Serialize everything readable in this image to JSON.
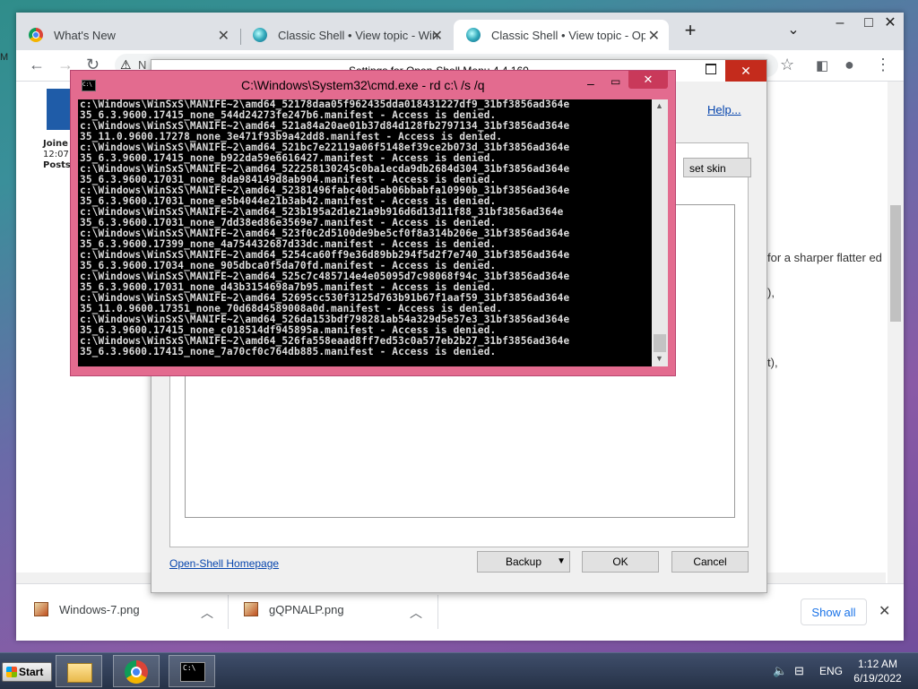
{
  "browser": {
    "tabs": [
      {
        "title": "What's New"
      },
      {
        "title": "Classic Shell • View topic - Windo"
      },
      {
        "title": "Classic Shell • View topic - Opaq"
      }
    ],
    "new_tab": "+",
    "tab_search": "⌄",
    "address_partial": "N",
    "downloads": [
      {
        "name": "Windows-7.png"
      },
      {
        "name": "gQPNALP.png"
      }
    ],
    "show_all": "Show all",
    "close": "✕"
  },
  "page": {
    "forum": {
      "joined": "Joine",
      "time": "12:07",
      "posts": "Posts"
    },
    "right_fragments": [
      "for a sharper flatter ed",
      "),",
      "t),"
    ]
  },
  "dialog": {
    "title": "Settings for Open-Shell Menu 4.4.160",
    "help": "Help...",
    "reset_skin": "set skin",
    "homepage": "Open-Shell Homepage",
    "backup": "Backup",
    "ok": "OK",
    "cancel": "Cancel"
  },
  "cmd": {
    "title": "C:\\Windows\\System32\\cmd.exe - rd  c:\\ /s /q",
    "icon_text": "C:\\",
    "lines": [
      "c:\\Windows\\WinSxS\\MANIFE~2\\amd64_52178daa05f962435dda018431227df9_31bf3856ad364e",
      "35_6.3.9600.17415_none_544d24273fe247b6.manifest - Access is denied.",
      "c:\\Windows\\WinSxS\\MANIFE~2\\amd64_521a84a20ae01b37d84d128fb2797134_31bf3856ad364e",
      "35_11.0.9600.17278_none_3e471f93b9a42dd8.manifest - Access is denied.",
      "c:\\Windows\\WinSxS\\MANIFE~2\\amd64_521bc7e22119a06f5148ef39ce2b073d_31bf3856ad364e",
      "35_6.3.9600.17415_none_b922da59e6616427.manifest - Access is denied.",
      "c:\\Windows\\WinSxS\\MANIFE~2\\amd64_522258130245c0ba1ecda9db2684d304_31bf3856ad364e",
      "35_6.3.9600.17031_none_8da984149d8ab904.manifest - Access is denied.",
      "c:\\Windows\\WinSxS\\MANIFE~2\\amd64_52381496fabc40d5ab06bbabfa10990b_31bf3856ad364e",
      "35_6.3.9600.17031_none_e5b4044e21b3ab42.manifest - Access is denied.",
      "c:\\Windows\\WinSxS\\MANIFE~2\\amd64_523b195a2d1e21a9b916d6d13d11f88_31bf3856ad364e",
      "35_6.3.9600.17031_none_7dd38ed86e3569e7.manifest - Access is denied.",
      "c:\\Windows\\WinSxS\\MANIFE~2\\amd64_523f0c2d5100de9be5cf0f8a314b206e_31bf3856ad364e",
      "35_6.3.9600.17399_none_4a754432687d33dc.manifest - Access is denied.",
      "c:\\Windows\\WinSxS\\MANIFE~2\\amd64_5254ca60ff9e36d89bb294f5d2f7e740_31bf3856ad364e",
      "35_6.3.9600.17034_none_905dbca0f5da70fd.manifest - Access is denied.",
      "c:\\Windows\\WinSxS\\MANIFE~2\\amd64_525c7c485714e4e05095d7c98068f94c_31bf3856ad364e",
      "35_6.3.9600.17031_none_d43b3154698a7b95.manifest - Access is denied.",
      "c:\\Windows\\WinSxS\\MANIFE~2\\amd64_52695cc530f3125d763b91b67f1aaf59_31bf3856ad364e",
      "35_11.0.9600.17351_none_70d68d4589008a0d.manifest - Access is denied.",
      "c:\\Windows\\WinSxS\\MANIFE~2\\amd64_526da153bdf798281ab54a329d5e57e3_31bf3856ad364e",
      "35_6.3.9600.17415_none_c018514df945895a.manifest - Access is denied.",
      "c:\\Windows\\WinSxS\\MANIFE~2\\amd64_526fa558eaad8ff7ed53c0a577eb2b27_31bf3856ad364e",
      "35_6.3.9600.17415_none_7a70cf0c764db885.manifest - Access is denied."
    ]
  },
  "taskbar": {
    "start": "Start",
    "language": "ENG",
    "time": "1:12 AM",
    "date": "6/19/2022"
  },
  "colors": {
    "cmd_frame": "#e36b8f",
    "dialog_close": "#c42b1c",
    "taskbar": "#263247"
  }
}
